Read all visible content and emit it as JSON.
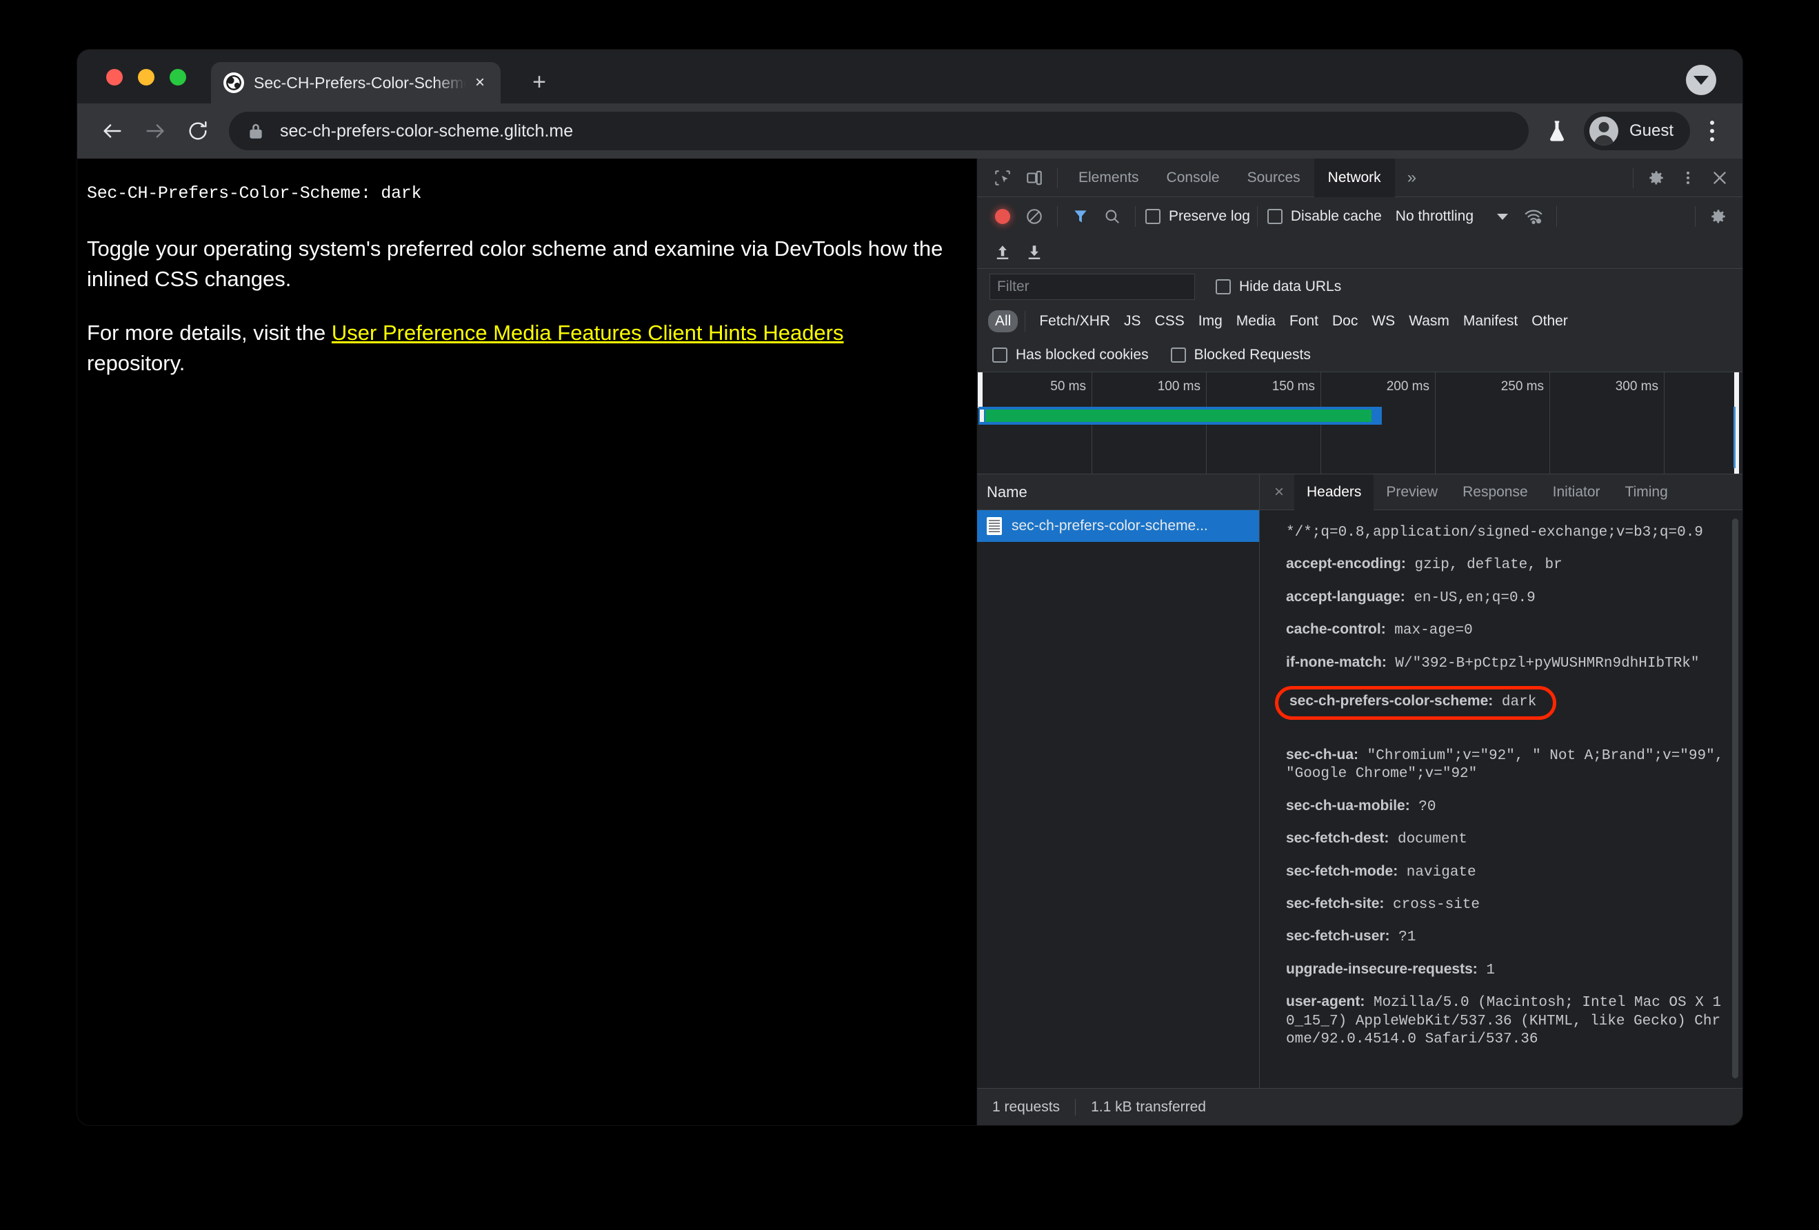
{
  "browser": {
    "tab": {
      "title": "Sec-CH-Prefers-Color-Scheme",
      "favicon": "globe-icon",
      "close": "×"
    },
    "new_tab": "+",
    "tabstrip_collapse": "chevron-down-icon",
    "omnibox": {
      "url": "sec-ch-prefers-color-scheme.glitch.me",
      "lock": "lock-icon"
    },
    "profile": {
      "name": "Guest"
    },
    "flask": "flask-icon",
    "menu": "kebab-menu-icon"
  },
  "page": {
    "header_line": "Sec-CH-Prefers-Color-Scheme: dark",
    "para1": "Toggle your operating system's preferred color scheme and examine via DevTools how the inlined CSS changes.",
    "para2_before": "For more details, visit the ",
    "link": "User Preference Media Features Client Hints Headers",
    "para2_after": " repository.",
    "link_color": "#ffff00"
  },
  "devtools": {
    "tabs": [
      {
        "label": "Elements",
        "active": false
      },
      {
        "label": "Console",
        "active": false
      },
      {
        "label": "Sources",
        "active": false
      },
      {
        "label": "Network",
        "active": true
      }
    ],
    "tab_overflow": "»",
    "right_icons": [
      "settings-gear-icon",
      "kebab-menu-icon",
      "close-icon"
    ],
    "left_icons": [
      "inspect-element-icon",
      "device-toolbar-icon"
    ],
    "network_toolbar": {
      "record_label": "record-button",
      "clear_label": "clear-button",
      "filter_label": "filter-funnel-icon",
      "search_label": "search-icon",
      "preserve_log": "Preserve log",
      "disable_cache": "Disable cache",
      "throttling": "No throttling",
      "network_conditions": "network-conditions-icon",
      "settings": "settings-gear-icon"
    },
    "io_row": {
      "import": "import-har-icon",
      "export": "export-har-icon"
    },
    "filter": {
      "placeholder": "Filter",
      "value": "",
      "hide_data_urls": "Hide data URLs"
    },
    "type_filters": [
      "All",
      "Fetch/XHR",
      "JS",
      "CSS",
      "Img",
      "Media",
      "Font",
      "Doc",
      "WS",
      "Wasm",
      "Manifest",
      "Other"
    ],
    "type_filter_selected": "All",
    "blocked_row": [
      "Has blocked cookies",
      "Blocked Requests"
    ],
    "overview": {
      "ticks": [
        "50 ms",
        "100 ms",
        "150 ms",
        "200 ms",
        "250 ms",
        "300 ms"
      ],
      "bar_color_outer": "#1a73c8",
      "bar_color_inner": "#0ca750"
    },
    "request_list": {
      "column_header": "Name",
      "rows": [
        {
          "name": "sec-ch-prefers-color-scheme...",
          "selected": true,
          "icon": "document-icon"
        }
      ]
    },
    "status_bar": {
      "requests": "1 requests",
      "transferred": "1.1 kB transferred"
    },
    "detail": {
      "close": "×",
      "tabs": [
        {
          "label": "Headers",
          "active": true
        },
        {
          "label": "Preview",
          "active": false
        },
        {
          "label": "Response",
          "active": false
        },
        {
          "label": "Initiator",
          "active": false
        },
        {
          "label": "Timing",
          "active": false
        }
      ],
      "headers": [
        {
          "name": "",
          "value": "*/*;q=0.8,application/signed-exchange;v=b3;q=0.9",
          "highlighted": false
        },
        {
          "name": "accept-encoding:",
          "value": " gzip, deflate, br",
          "highlighted": false
        },
        {
          "name": "accept-language:",
          "value": " en-US,en;q=0.9",
          "highlighted": false
        },
        {
          "name": "cache-control:",
          "value": " max-age=0",
          "highlighted": false
        },
        {
          "name": "if-none-match:",
          "value": " W/\"392-B+pCtpzl+pyWUSHMRn9dhHIbTRk\"",
          "highlighted": false
        },
        {
          "name": "sec-ch-prefers-color-scheme:",
          "value": " dark",
          "highlighted": true
        },
        {
          "name": "sec-ch-ua:",
          "value": " \"Chromium\";v=\"92\", \" Not A;Brand\";v=\"99\", \"Google Chrome\";v=\"92\"",
          "highlighted": false
        },
        {
          "name": "sec-ch-ua-mobile:",
          "value": " ?0",
          "highlighted": false
        },
        {
          "name": "sec-fetch-dest:",
          "value": " document",
          "highlighted": false
        },
        {
          "name": "sec-fetch-mode:",
          "value": " navigate",
          "highlighted": false
        },
        {
          "name": "sec-fetch-site:",
          "value": " cross-site",
          "highlighted": false
        },
        {
          "name": "sec-fetch-user:",
          "value": " ?1",
          "highlighted": false
        },
        {
          "name": "upgrade-insecure-requests:",
          "value": " 1",
          "highlighted": false
        },
        {
          "name": "user-agent:",
          "value": " Mozilla/5.0 (Macintosh; Intel Mac OS X 10_15_7) AppleWebKit/537.36 (KHTML, like Gecko) Chrome/92.0.4514.0 Safari/537.36",
          "highlighted": false
        }
      ],
      "highlight_color": "#ff2600"
    }
  }
}
